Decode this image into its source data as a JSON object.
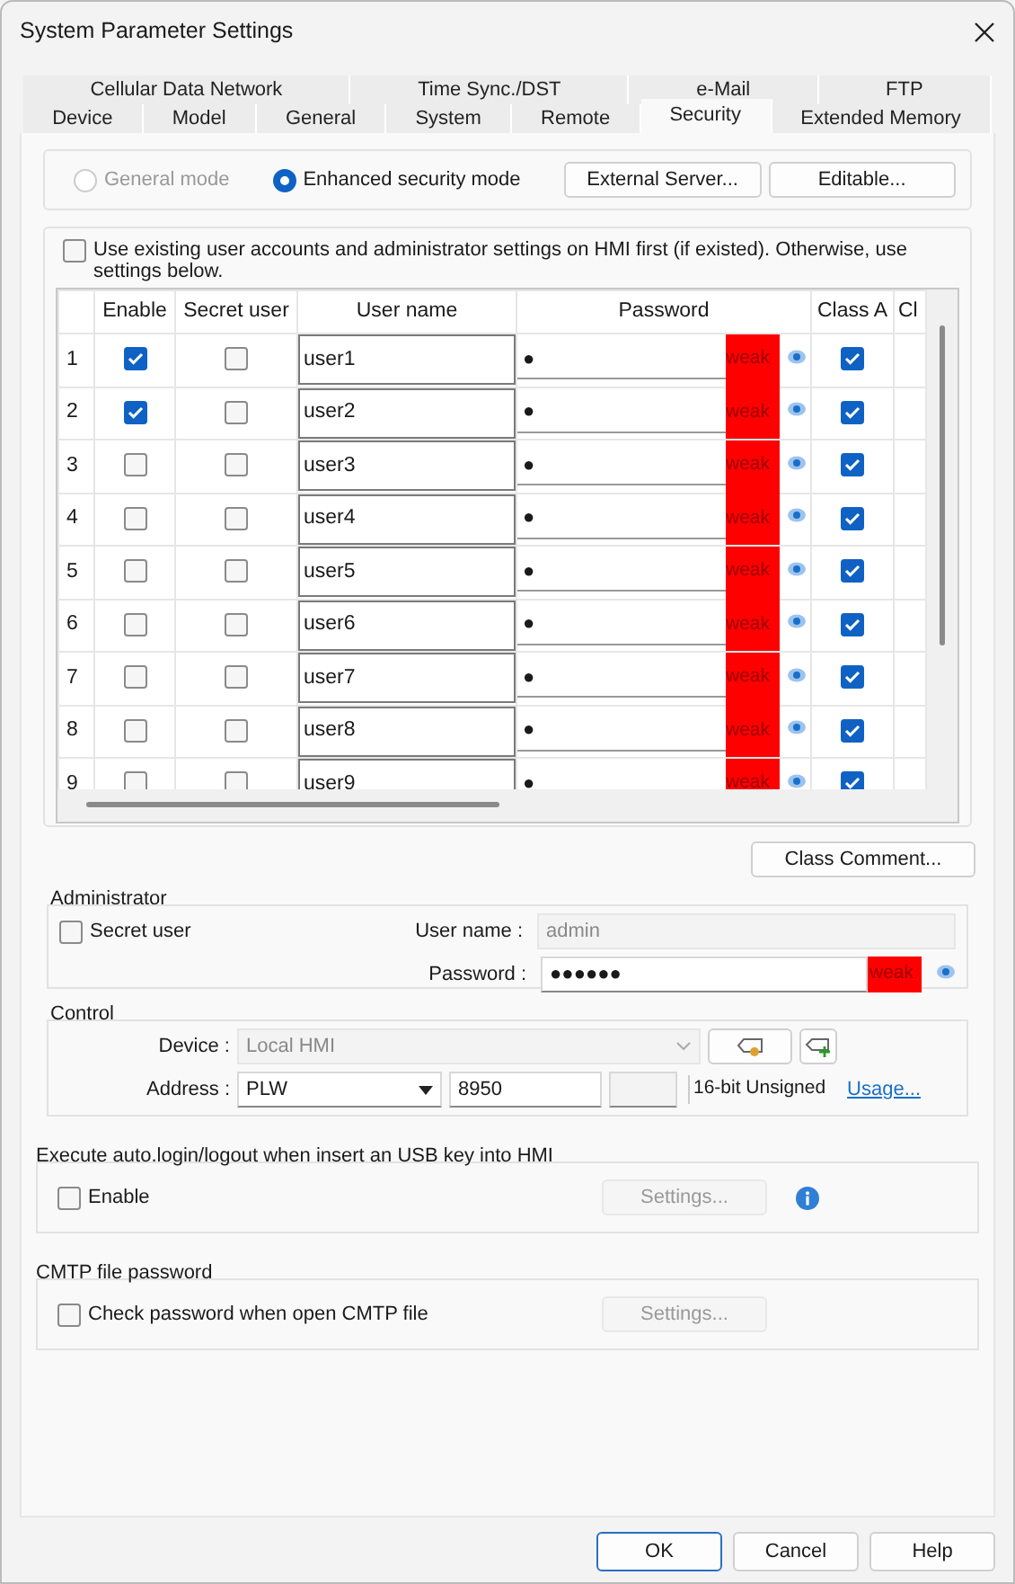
{
  "window": {
    "title": "System Parameter Settings"
  },
  "tab_rows": [
    {
      "tabs": [
        {
          "label": "Cellular Data Network",
          "selected": false
        },
        {
          "label": "Time Sync./DST",
          "selected": false
        },
        {
          "label": "e-Mail",
          "selected": false
        },
        {
          "label": "FTP",
          "selected": false
        }
      ]
    },
    {
      "tabs": [
        {
          "label": "Device",
          "selected": false
        },
        {
          "label": "Model",
          "selected": false
        },
        {
          "label": "General",
          "selected": false
        },
        {
          "label": "System",
          "selected": false
        },
        {
          "label": "Remote",
          "selected": false
        },
        {
          "label": "Security",
          "selected": true
        },
        {
          "label": "Extended Memory",
          "selected": false
        }
      ]
    }
  ],
  "mode": {
    "options": [
      {
        "label": "General mode",
        "selected": false,
        "disabled": true
      },
      {
        "label": "Enhanced security mode",
        "selected": true,
        "disabled": false
      }
    ],
    "buttons": [
      "External Server...",
      "Editable..."
    ]
  },
  "users": {
    "use_existing": {
      "label": "Use existing user accounts and administrator settings on HMI first (if existed). Otherwise, use settings below.",
      "checked": false
    },
    "columns": [
      "Enable",
      "Secret user",
      "User name",
      "Password",
      "Class A",
      "Cl"
    ],
    "rows": [
      {
        "number": "1",
        "enable": true,
        "secret_user": false,
        "user_name": "user1",
        "password": "●",
        "strength": {
          "text": "weak",
          "color": "#ff0000"
        },
        "class_a": true
      },
      {
        "number": "2",
        "enable": true,
        "secret_user": false,
        "user_name": "user2",
        "password": "●",
        "strength": {
          "text": "weak",
          "color": "#ff0000"
        },
        "class_a": true
      },
      {
        "number": "3",
        "enable": false,
        "secret_user": false,
        "user_name": "user3",
        "password": "●",
        "strength": {
          "text": "weak",
          "color": "#ff0000"
        },
        "class_a": true
      },
      {
        "number": "4",
        "enable": false,
        "secret_user": false,
        "user_name": "user4",
        "password": "●",
        "strength": {
          "text": "weak",
          "color": "#ff0000"
        },
        "class_a": true
      },
      {
        "number": "5",
        "enable": false,
        "secret_user": false,
        "user_name": "user5",
        "password": "●",
        "strength": {
          "text": "weak",
          "color": "#ff0000"
        },
        "class_a": true
      },
      {
        "number": "6",
        "enable": false,
        "secret_user": false,
        "user_name": "user6",
        "password": "●",
        "strength": {
          "text": "weak",
          "color": "#ff0000"
        },
        "class_a": true
      },
      {
        "number": "7",
        "enable": false,
        "secret_user": false,
        "user_name": "user7",
        "password": "●",
        "strength": {
          "text": "weak",
          "color": "#ff0000"
        },
        "class_a": true
      },
      {
        "number": "8",
        "enable": false,
        "secret_user": false,
        "user_name": "user8",
        "password": "●",
        "strength": {
          "text": "weak",
          "color": "#ff0000"
        },
        "class_a": true
      },
      {
        "number": "9",
        "enable": false,
        "secret_user": false,
        "user_name": "user9",
        "password": "●",
        "strength": {
          "text": "weak",
          "color": "#ff0000"
        },
        "class_a": true
      }
    ],
    "class_comment_button": "Class Comment..."
  },
  "administrator": {
    "title": "Administrator",
    "secret_user": {
      "label": "Secret user",
      "checked": false
    },
    "user_name_label": "User name :",
    "user_name": "admin",
    "password_label": "Password :",
    "password": "●●●●●●",
    "strength": {
      "text": "weak",
      "color": "#ff0000"
    }
  },
  "control": {
    "title": "Control",
    "device_label": "Device :",
    "device": "Local HMI",
    "device_disabled": true,
    "address_label": "Address :",
    "address_type": "PLW",
    "address": "8950",
    "data_type": "16-bit Unsigned",
    "usage_link": "Usage..."
  },
  "usb": {
    "title": "Execute auto.login/logout when insert an USB key into HMI",
    "enable": {
      "label": "Enable",
      "checked": false
    },
    "settings_button": {
      "label": "Settings...",
      "disabled": true
    }
  },
  "cmtp": {
    "title": "CMTP file password",
    "check": {
      "label": "Check password when open CMTP file",
      "checked": false
    },
    "settings_button": {
      "label": "Settings...",
      "disabled": true
    }
  },
  "buttons": [
    {
      "label": "OK",
      "default": true
    },
    {
      "label": "Cancel",
      "default": false
    },
    {
      "label": "Help",
      "default": false
    }
  ]
}
